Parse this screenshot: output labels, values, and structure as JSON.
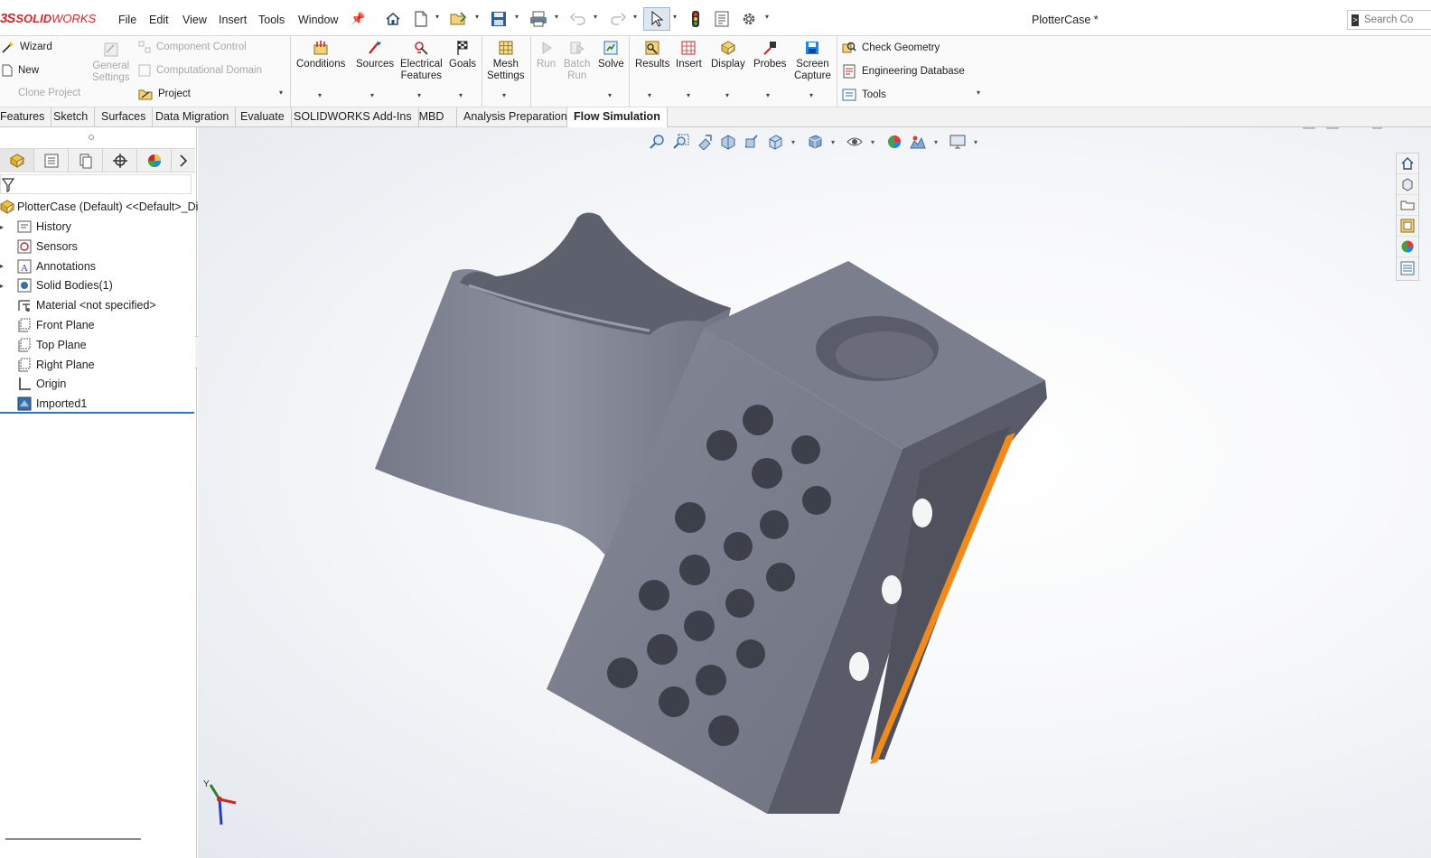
{
  "app": {
    "brand_ds": "3S",
    "brand_solid": "SOLID",
    "brand_works": "WORKS",
    "document_title": "PlotterCase *",
    "search_placeholder": "Search Co"
  },
  "menu": [
    "File",
    "Edit",
    "View",
    "Insert",
    "Tools",
    "Window"
  ],
  "quick_access": [
    "home-icon",
    "new-document-icon",
    "open-icon",
    "save-icon",
    "print-icon",
    "undo-icon",
    "redo-icon",
    "select-icon",
    "rebuild-icon",
    "file-properties-icon",
    "options-icon"
  ],
  "command_manager": {
    "left_column": [
      {
        "label": "Wizard",
        "enabled": true
      },
      {
        "label": "New",
        "enabled": true
      },
      {
        "label": "Clone Project",
        "enabled": false
      }
    ],
    "general_settings": {
      "line1": "General",
      "line2": "Settings"
    },
    "mid_column": [
      {
        "label": "Component Control",
        "enabled": false
      },
      {
        "label": "Computational Domain",
        "enabled": false
      },
      {
        "label": "Project",
        "enabled": true
      }
    ],
    "buttons": [
      {
        "line1": "Conditions",
        "line2": "",
        "enabled": true
      },
      {
        "line1": "Sources",
        "line2": "",
        "enabled": true
      },
      {
        "line1": "Electrical",
        "line2": "Features",
        "enabled": true
      },
      {
        "line1": "Goals",
        "line2": "",
        "enabled": true
      },
      {
        "line1": "Mesh",
        "line2": "Settings",
        "enabled": true
      },
      {
        "line1": "Run",
        "line2": "",
        "enabled": false
      },
      {
        "line1": "Batch",
        "line2": "Run",
        "enabled": false
      },
      {
        "line1": "Solve",
        "line2": "",
        "enabled": true
      },
      {
        "line1": "Results",
        "line2": "",
        "enabled": true
      },
      {
        "line1": "Insert",
        "line2": "",
        "enabled": true
      },
      {
        "line1": "Display",
        "line2": "",
        "enabled": true
      },
      {
        "line1": "Probes",
        "line2": "",
        "enabled": true
      },
      {
        "line1": "Screen",
        "line2": "Capture",
        "enabled": true
      }
    ],
    "right_column": [
      "Check Geometry",
      "Engineering Database",
      "Tools"
    ]
  },
  "tabs": [
    {
      "label": "Features",
      "active": false
    },
    {
      "label": "Sketch",
      "active": false
    },
    {
      "label": "Surfaces",
      "active": false
    },
    {
      "label": "Data Migration",
      "active": false
    },
    {
      "label": "Evaluate",
      "active": false
    },
    {
      "label": "SOLIDWORKS Add-Ins",
      "active": false
    },
    {
      "label": "MBD",
      "active": false
    },
    {
      "label": "Analysis Preparation",
      "active": false
    },
    {
      "label": "Flow Simulation",
      "active": true
    }
  ],
  "feature_tree": {
    "root": "PlotterCase (Default) <<Default>_Disp",
    "items": [
      {
        "label": "History",
        "icon": "history-folder-icon",
        "expandable": true
      },
      {
        "label": "Sensors",
        "icon": "sensors-icon",
        "expandable": false
      },
      {
        "label": "Annotations",
        "icon": "annotations-icon",
        "expandable": true
      },
      {
        "label": "Solid Bodies(1)",
        "icon": "solid-bodies-icon",
        "expandable": true
      },
      {
        "label": "Material <not specified>",
        "icon": "material-icon",
        "expandable": false
      },
      {
        "label": "Front Plane",
        "icon": "plane-icon",
        "expandable": false
      },
      {
        "label": "Top Plane",
        "icon": "plane-icon",
        "expandable": false
      },
      {
        "label": "Right Plane",
        "icon": "plane-icon",
        "expandable": false
      },
      {
        "label": "Origin",
        "icon": "origin-icon",
        "expandable": false
      },
      {
        "label": "Imported1",
        "icon": "imported-body-icon",
        "expandable": false
      }
    ]
  },
  "triad": {
    "y_label": "Y"
  },
  "colors": {
    "part_body": "#8a8d99",
    "part_edge_highlight": "#f08a1c",
    "active_tab_accent": "#2f77bf",
    "brand_red": "#d6262b"
  }
}
